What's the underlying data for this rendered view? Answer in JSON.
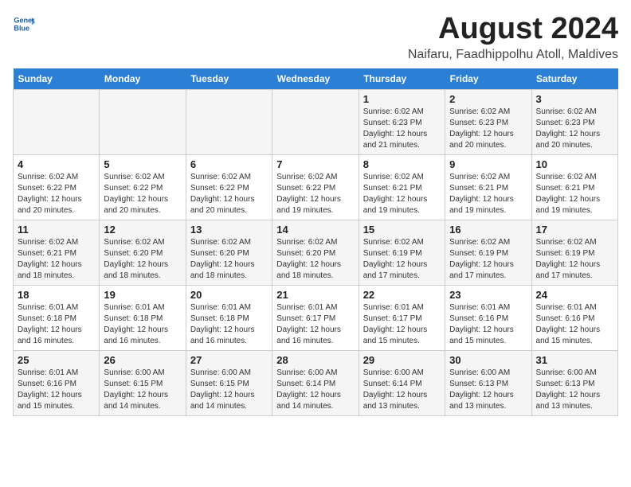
{
  "header": {
    "logo_line1": "General",
    "logo_line2": "Blue",
    "month_year": "August 2024",
    "location": "Naifaru, Faadhippolhu Atoll, Maldives"
  },
  "weekdays": [
    "Sunday",
    "Monday",
    "Tuesday",
    "Wednesday",
    "Thursday",
    "Friday",
    "Saturday"
  ],
  "weeks": [
    [
      {
        "day": "",
        "info": ""
      },
      {
        "day": "",
        "info": ""
      },
      {
        "day": "",
        "info": ""
      },
      {
        "day": "",
        "info": ""
      },
      {
        "day": "1",
        "info": "Sunrise: 6:02 AM\nSunset: 6:23 PM\nDaylight: 12 hours\nand 21 minutes."
      },
      {
        "day": "2",
        "info": "Sunrise: 6:02 AM\nSunset: 6:23 PM\nDaylight: 12 hours\nand 20 minutes."
      },
      {
        "day": "3",
        "info": "Sunrise: 6:02 AM\nSunset: 6:23 PM\nDaylight: 12 hours\nand 20 minutes."
      }
    ],
    [
      {
        "day": "4",
        "info": "Sunrise: 6:02 AM\nSunset: 6:22 PM\nDaylight: 12 hours\nand 20 minutes."
      },
      {
        "day": "5",
        "info": "Sunrise: 6:02 AM\nSunset: 6:22 PM\nDaylight: 12 hours\nand 20 minutes."
      },
      {
        "day": "6",
        "info": "Sunrise: 6:02 AM\nSunset: 6:22 PM\nDaylight: 12 hours\nand 20 minutes."
      },
      {
        "day": "7",
        "info": "Sunrise: 6:02 AM\nSunset: 6:22 PM\nDaylight: 12 hours\nand 19 minutes."
      },
      {
        "day": "8",
        "info": "Sunrise: 6:02 AM\nSunset: 6:21 PM\nDaylight: 12 hours\nand 19 minutes."
      },
      {
        "day": "9",
        "info": "Sunrise: 6:02 AM\nSunset: 6:21 PM\nDaylight: 12 hours\nand 19 minutes."
      },
      {
        "day": "10",
        "info": "Sunrise: 6:02 AM\nSunset: 6:21 PM\nDaylight: 12 hours\nand 19 minutes."
      }
    ],
    [
      {
        "day": "11",
        "info": "Sunrise: 6:02 AM\nSunset: 6:21 PM\nDaylight: 12 hours\nand 18 minutes."
      },
      {
        "day": "12",
        "info": "Sunrise: 6:02 AM\nSunset: 6:20 PM\nDaylight: 12 hours\nand 18 minutes."
      },
      {
        "day": "13",
        "info": "Sunrise: 6:02 AM\nSunset: 6:20 PM\nDaylight: 12 hours\nand 18 minutes."
      },
      {
        "day": "14",
        "info": "Sunrise: 6:02 AM\nSunset: 6:20 PM\nDaylight: 12 hours\nand 18 minutes."
      },
      {
        "day": "15",
        "info": "Sunrise: 6:02 AM\nSunset: 6:19 PM\nDaylight: 12 hours\nand 17 minutes."
      },
      {
        "day": "16",
        "info": "Sunrise: 6:02 AM\nSunset: 6:19 PM\nDaylight: 12 hours\nand 17 minutes."
      },
      {
        "day": "17",
        "info": "Sunrise: 6:02 AM\nSunset: 6:19 PM\nDaylight: 12 hours\nand 17 minutes."
      }
    ],
    [
      {
        "day": "18",
        "info": "Sunrise: 6:01 AM\nSunset: 6:18 PM\nDaylight: 12 hours\nand 16 minutes."
      },
      {
        "day": "19",
        "info": "Sunrise: 6:01 AM\nSunset: 6:18 PM\nDaylight: 12 hours\nand 16 minutes."
      },
      {
        "day": "20",
        "info": "Sunrise: 6:01 AM\nSunset: 6:18 PM\nDaylight: 12 hours\nand 16 minutes."
      },
      {
        "day": "21",
        "info": "Sunrise: 6:01 AM\nSunset: 6:17 PM\nDaylight: 12 hours\nand 16 minutes."
      },
      {
        "day": "22",
        "info": "Sunrise: 6:01 AM\nSunset: 6:17 PM\nDaylight: 12 hours\nand 15 minutes."
      },
      {
        "day": "23",
        "info": "Sunrise: 6:01 AM\nSunset: 6:16 PM\nDaylight: 12 hours\nand 15 minutes."
      },
      {
        "day": "24",
        "info": "Sunrise: 6:01 AM\nSunset: 6:16 PM\nDaylight: 12 hours\nand 15 minutes."
      }
    ],
    [
      {
        "day": "25",
        "info": "Sunrise: 6:01 AM\nSunset: 6:16 PM\nDaylight: 12 hours\nand 15 minutes."
      },
      {
        "day": "26",
        "info": "Sunrise: 6:00 AM\nSunset: 6:15 PM\nDaylight: 12 hours\nand 14 minutes."
      },
      {
        "day": "27",
        "info": "Sunrise: 6:00 AM\nSunset: 6:15 PM\nDaylight: 12 hours\nand 14 minutes."
      },
      {
        "day": "28",
        "info": "Sunrise: 6:00 AM\nSunset: 6:14 PM\nDaylight: 12 hours\nand 14 minutes."
      },
      {
        "day": "29",
        "info": "Sunrise: 6:00 AM\nSunset: 6:14 PM\nDaylight: 12 hours\nand 13 minutes."
      },
      {
        "day": "30",
        "info": "Sunrise: 6:00 AM\nSunset: 6:13 PM\nDaylight: 12 hours\nand 13 minutes."
      },
      {
        "day": "31",
        "info": "Sunrise: 6:00 AM\nSunset: 6:13 PM\nDaylight: 12 hours\nand 13 minutes."
      }
    ]
  ]
}
